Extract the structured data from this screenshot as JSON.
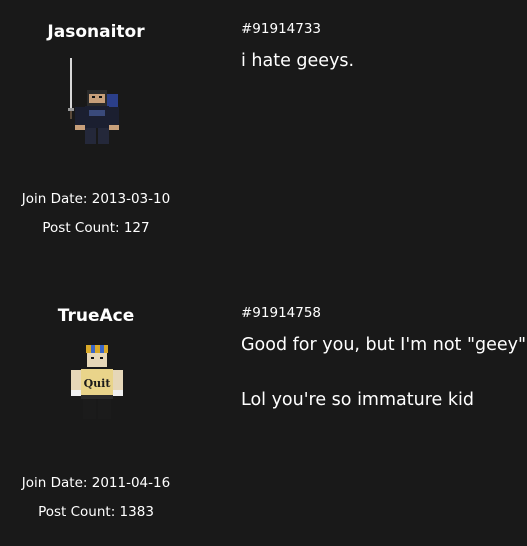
{
  "posts": [
    {
      "username": "Jasonaitor",
      "join_date": "Join Date: 2013-03-10",
      "post_count": "Post Count: 127",
      "post_id": "#91914733",
      "lines": [
        "i hate geeys."
      ],
      "avatar_icon": "ninja-sword-avatar"
    },
    {
      "username": "TrueAce",
      "join_date": "Join Date: 2011-04-16",
      "post_count": "Post Count: 1383",
      "post_id": "#91914758",
      "lines": [
        "Good for you, but I'm not \"geey\"",
        "Lol you're so immature kid"
      ],
      "avatar_icon": "quit-shirt-avatar"
    }
  ],
  "colors": {
    "background": "#191919",
    "text": "#ffffff"
  }
}
